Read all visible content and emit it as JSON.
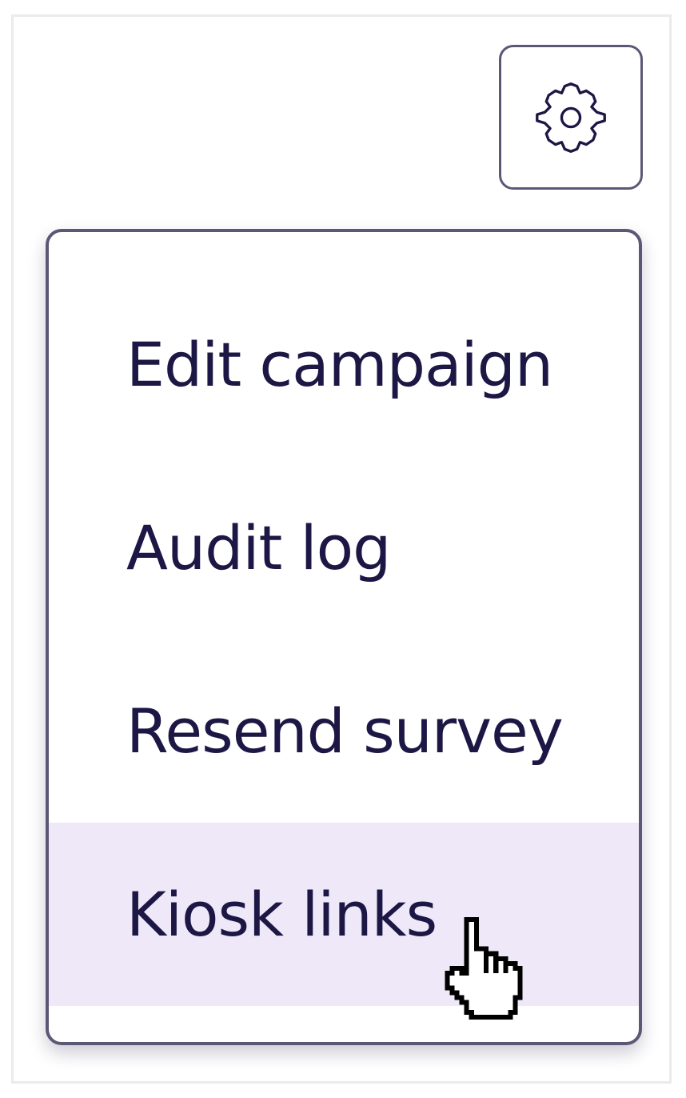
{
  "settings": {
    "icon": "gear-icon"
  },
  "menu": {
    "items": [
      {
        "label": "Edit campaign"
      },
      {
        "label": "Audit log"
      },
      {
        "label": "Resend survey"
      },
      {
        "label": "Kiosk links",
        "state": "hovered"
      }
    ]
  },
  "colors": {
    "text": "#1c1744",
    "border": "#5b5875",
    "hover_background": "#efe8f8"
  },
  "cursor": {
    "icon": "hand-pointer-icon"
  }
}
